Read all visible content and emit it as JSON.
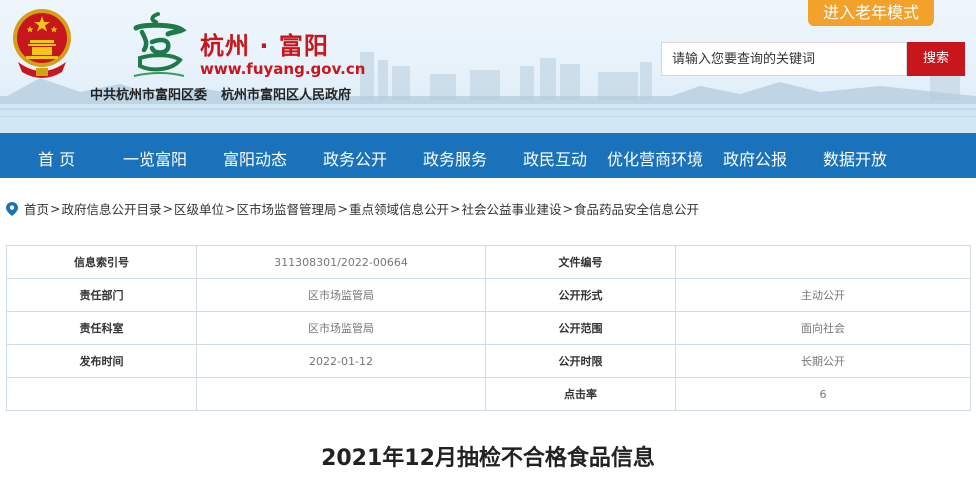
{
  "header": {
    "city_name": "杭州 · 富阳",
    "site_url": "www.fuyang.gov.cn",
    "org_party": "中共杭州市富阳区委",
    "org_gov": "杭州市富阳区人民政府",
    "elder_mode_label": "进入老年模式",
    "search_placeholder": "请输入您要查询的关键词",
    "search_button_label": "搜索",
    "accent_color": "#c8161d"
  },
  "nav": {
    "items": [
      "首 页",
      "一览富阳",
      "富阳动态",
      "政务公开",
      "政务服务",
      "政民互动",
      "优化营商环境",
      "政府公报",
      "数据开放"
    ],
    "bg_color": "#1a73ba"
  },
  "breadcrumb": {
    "items": [
      "首页",
      "政府信息公开目录",
      "区级单位",
      "区市场监督管理局",
      "重点领域信息公开",
      "社会公益事业建设",
      "食品药品安全信息公开"
    ],
    "separator": ">"
  },
  "info_table": {
    "rows": [
      {
        "k1": "信息索引号",
        "v1": "311308301/2022-00664",
        "k2": "文件编号",
        "v2": ""
      },
      {
        "k1": "责任部门",
        "v1": "区市场监管局",
        "k2": "公开形式",
        "v2": "主动公开"
      },
      {
        "k1": "责任科室",
        "v1": "区市场监管局",
        "k2": "公开范围",
        "v2": "面向社会"
      },
      {
        "k1": "发布时间",
        "v1": "2022-01-12",
        "k2": "公开时限",
        "v2": "长期公开"
      },
      {
        "k1": "",
        "v1": "",
        "k2": "点击率",
        "v2": "6"
      }
    ]
  },
  "article": {
    "title": "2021年12月抽检不合格食品信息"
  }
}
